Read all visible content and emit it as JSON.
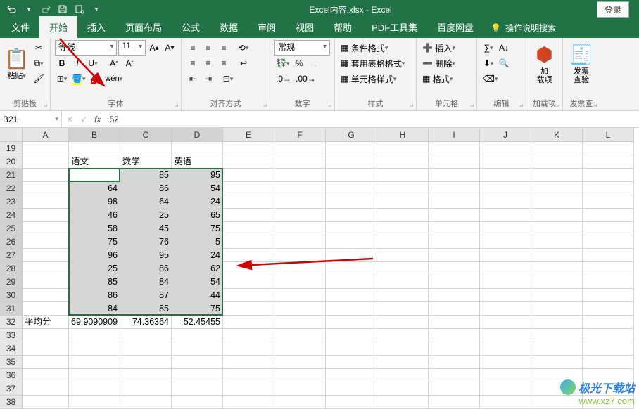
{
  "title": "Excel内容.xlsx - Excel",
  "login": "登录",
  "tabs": {
    "file": "文件",
    "home": "开始",
    "insert": "插入",
    "layout": "页面布局",
    "formula": "公式",
    "data": "数据",
    "review": "审阅",
    "view": "视图",
    "help": "帮助",
    "pdf": "PDF工具集",
    "baidu": "百度网盘"
  },
  "tellme": "操作说明搜索",
  "groups": {
    "clipboard": {
      "label": "剪贴板",
      "paste": "粘贴"
    },
    "font": {
      "label": "字体",
      "name": "等线",
      "size": "11"
    },
    "align": {
      "label": "对齐方式"
    },
    "number": {
      "label": "数字",
      "format": "常规"
    },
    "styles": {
      "label": "样式",
      "cond": "条件格式",
      "table": "套用表格格式",
      "cell": "单元格样式"
    },
    "cells": {
      "label": "单元格",
      "insert": "插入",
      "delete": "删除",
      "format": "格式"
    },
    "editing": {
      "label": "编辑"
    },
    "addin": {
      "label": "加载项",
      "btn": "加\n载项"
    },
    "invoice": {
      "label": "发票查",
      "btn": "发票\n查验"
    }
  },
  "namebox": "B21",
  "formula": "52",
  "cols": [
    "A",
    "B",
    "C",
    "D",
    "E",
    "F",
    "G",
    "H",
    "I",
    "J",
    "K",
    "L"
  ],
  "rows": [
    "19",
    "20",
    "21",
    "22",
    "23",
    "24",
    "25",
    "26",
    "27",
    "28",
    "29",
    "30",
    "31",
    "32",
    "33",
    "34",
    "35",
    "36",
    "37",
    "38"
  ],
  "headers": {
    "b": "语文",
    "c": "数学",
    "d": "英语"
  },
  "avg_label": "平均分",
  "chart_data": {
    "type": "table",
    "columns": [
      "语文",
      "数学",
      "英语"
    ],
    "rows": [
      [
        52,
        85,
        95
      ],
      [
        64,
        86,
        54
      ],
      [
        98,
        64,
        24
      ],
      [
        46,
        25,
        65
      ],
      [
        58,
        45,
        75
      ],
      [
        75,
        76,
        5
      ],
      [
        96,
        95,
        24
      ],
      [
        25,
        86,
        62
      ],
      [
        85,
        84,
        54
      ],
      [
        86,
        87,
        44
      ],
      [
        84,
        85,
        75
      ]
    ],
    "averages": [
      69.9090909,
      74.36364,
      52.45455
    ]
  },
  "watermark": {
    "name": "极光下载站",
    "url": "www.xz7.com"
  }
}
